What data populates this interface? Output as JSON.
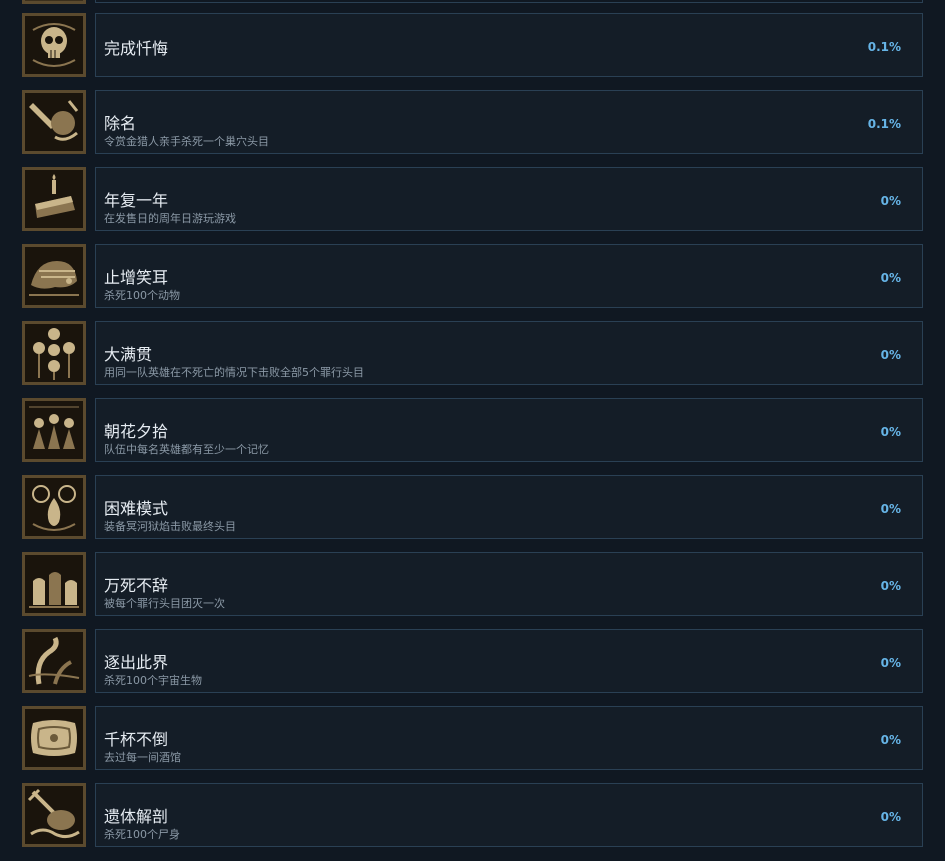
{
  "achievements": [
    {
      "title": "完成忏悔",
      "desc": "",
      "pct": "0.1%",
      "icon": "skull-icon"
    },
    {
      "title": "除名",
      "desc": "令赏金猎人亲手杀死一个巢穴头目",
      "pct": "0.1%",
      "icon": "bounty-hunter-icon"
    },
    {
      "title": "年复一年",
      "desc": "在发售日的周年日游玩游戏",
      "pct": "0%",
      "icon": "cake-candle-icon"
    },
    {
      "title": "止增笑耳",
      "desc": "杀死100个动物",
      "pct": "0%",
      "icon": "beast-icon"
    },
    {
      "title": "大满贯",
      "desc": "用同一队英雄在不死亡的情况下击败全部5个罪行头目",
      "pct": "0%",
      "icon": "five-emblems-icon"
    },
    {
      "title": "朝花夕拾",
      "desc": "队伍中每名英雄都有至少一个记忆",
      "pct": "0%",
      "icon": "heroes-group-icon"
    },
    {
      "title": "困难模式",
      "desc": "装备冥河狱焰击败最终头目",
      "pct": "0%",
      "icon": "hellfire-icon"
    },
    {
      "title": "万死不辞",
      "desc": "被每个罪行头目团灭一次",
      "pct": "0%",
      "icon": "graveyard-icon"
    },
    {
      "title": "逐出此界",
      "desc": "杀死100个宇宙生物",
      "pct": "0%",
      "icon": "tentacle-icon"
    },
    {
      "title": "千杯不倒",
      "desc": "去过每一间酒馆",
      "pct": "0%",
      "icon": "pillow-icon"
    },
    {
      "title": "遗体解剖",
      "desc": "杀死100个尸身",
      "pct": "0%",
      "icon": "corpse-sword-icon"
    }
  ]
}
